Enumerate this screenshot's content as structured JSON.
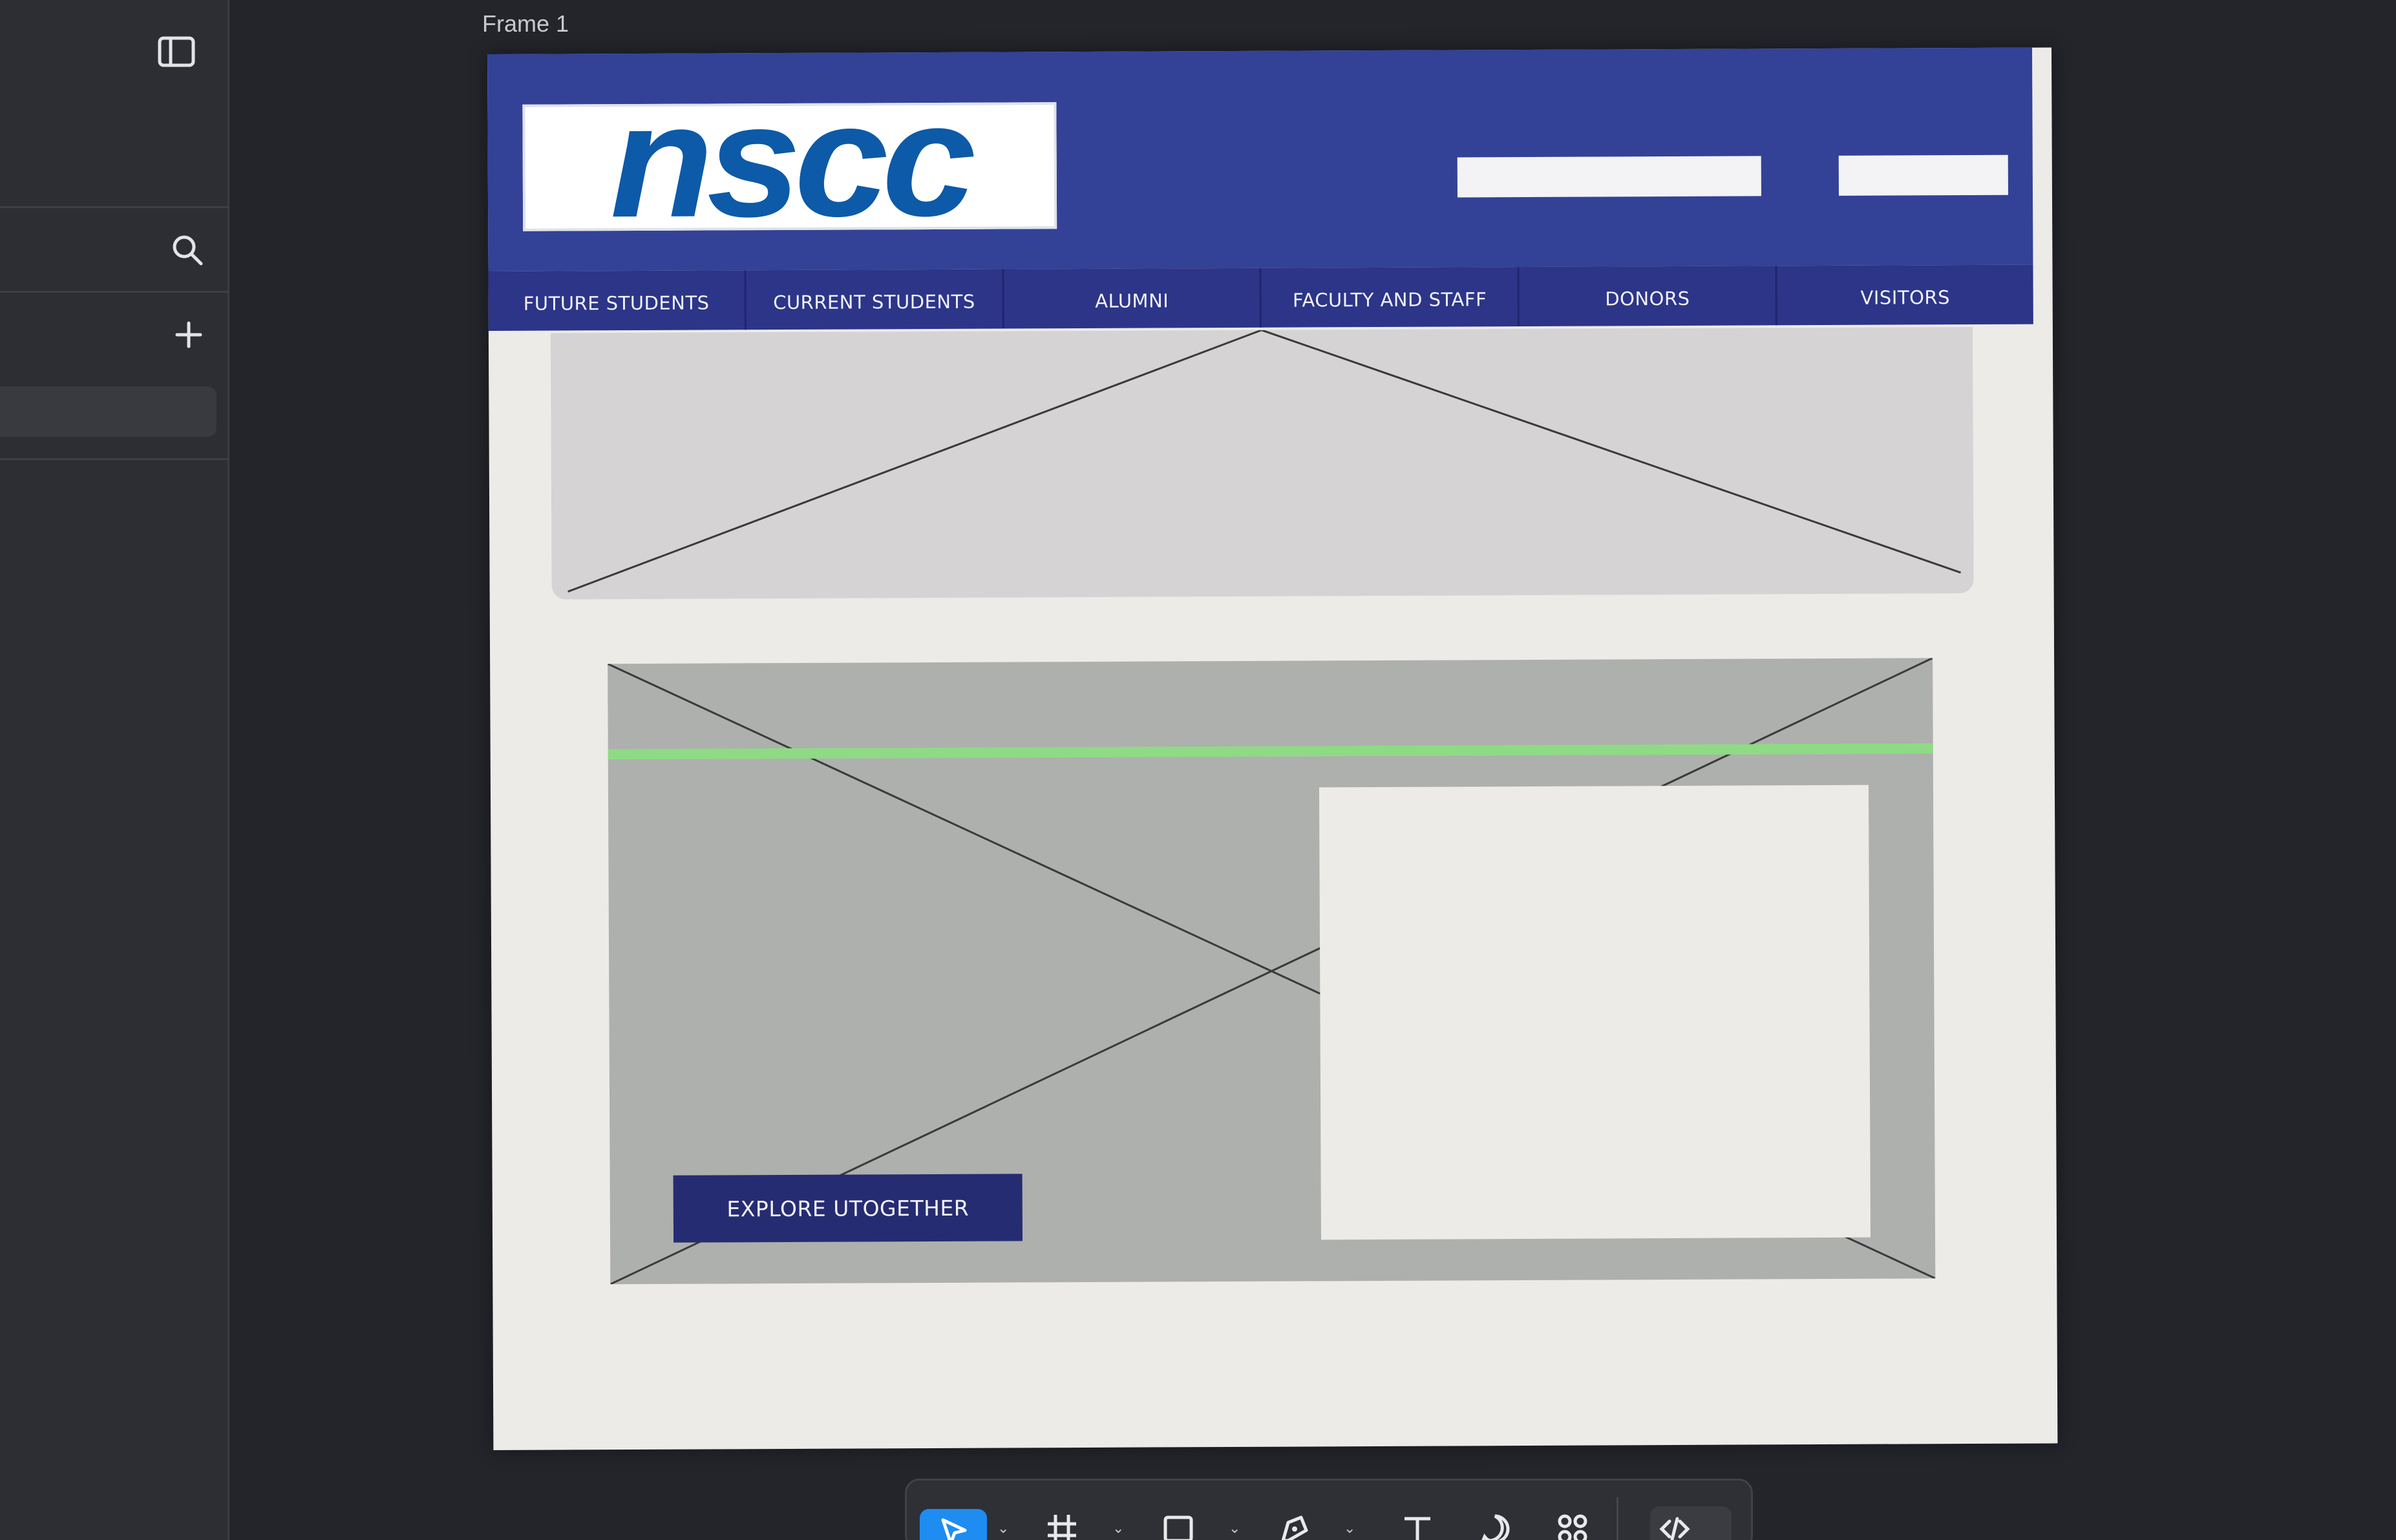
{
  "canvas": {
    "frame_label": "Frame 1"
  },
  "sidebar": {
    "icons": [
      "panel-toggle-icon",
      "search-icon",
      "plus-icon"
    ]
  },
  "page": {
    "logo_text": "nscc",
    "nav": [
      {
        "label": "FUTURE STUDENTS"
      },
      {
        "label": "CURRENT STUDENTS"
      },
      {
        "label": "ALUMNI"
      },
      {
        "label": "FACULTY AND STAFF"
      },
      {
        "label": "DONORS"
      },
      {
        "label": "VISITORS"
      }
    ],
    "cta_label": "EXPLORE UTOGETHER"
  },
  "toolbar": {
    "tools": [
      "move-tool-icon",
      "frame-tool-icon",
      "rectangle-tool-icon",
      "pen-tool-icon",
      "text-tool-icon",
      "comment-tool-icon",
      "components-icon",
      "dev-mode-icon"
    ]
  },
  "colors": {
    "header_blue": "#334296",
    "nav_blue": "#2c3588",
    "logo_blue": "#0d5aa8",
    "cta_navy": "#262c72",
    "guide_green": "#8fda85",
    "active_tool": "#1f8cf2"
  }
}
